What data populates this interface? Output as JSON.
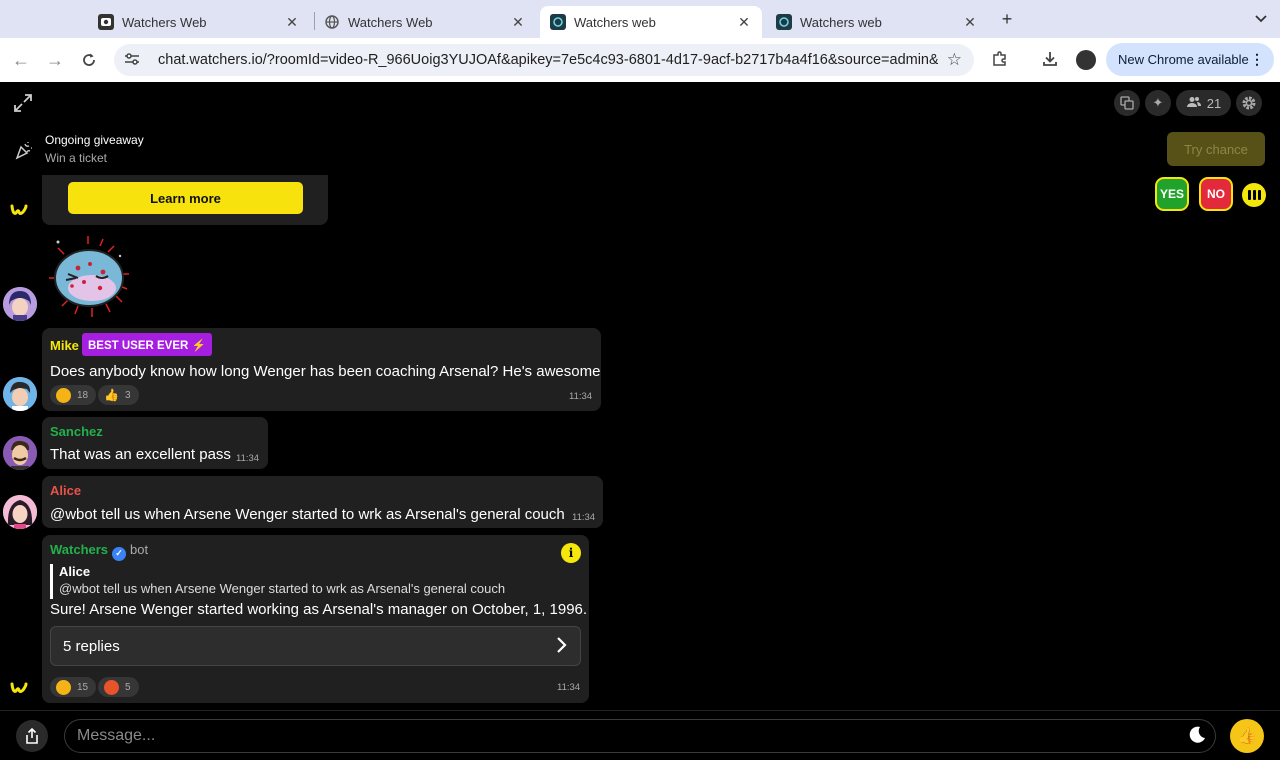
{
  "browser": {
    "tabs": [
      {
        "title": "Watchers Web",
        "close": "✕"
      },
      {
        "title": "Watchers Web",
        "close": "✕"
      },
      {
        "title": "Watchers web",
        "close": "✕"
      },
      {
        "title": "Watchers web",
        "close": "✕"
      }
    ],
    "new_tab": "+",
    "url": "chat.watchers.io/?roomId=video-R_966Uoig3YUJOAf&apikey=7e5c4c93-6801-4d17-9acf-b2717b4a4f16&source=admin&...",
    "update_label": "New Chrome available"
  },
  "app": {
    "viewer_count": "21",
    "giveaway": {
      "title": "Ongoing giveaway",
      "subtitle": "Win a ticket",
      "button": "Learn more"
    },
    "try_chance": "Try chance",
    "poll": {
      "yes": "YES",
      "no": "NO"
    },
    "messages": [
      {
        "author": "Mike",
        "author_color": "#f5e70b",
        "badge": "BEST USER EVER ⚡",
        "text": "Does anybody know how long Wenger has been coaching Arsenal? He's awesome",
        "time": "11:34",
        "reactions": [
          {
            "emoji": "heart-eyes",
            "count": "18"
          },
          {
            "emoji": "thumbs-up",
            "count": "3"
          }
        ]
      },
      {
        "author": "Sanchez",
        "author_color": "#22b14c",
        "text": "That was an excellent pass",
        "time": "11:34"
      },
      {
        "author": "Alice",
        "author_color": "#e8534a",
        "text": "@wbot tell us when Arsene Wenger started to wrk as Arsenal's general couch",
        "time": "11:34"
      },
      {
        "author": "Watchers",
        "author_color": "#22b14c",
        "tag": "bot",
        "quote_author": "Alice",
        "quote_text": "@wbot tell us when Arsene Wenger started to wrk as Arsenal's general couch",
        "text": "Sure! Arsene Wenger started working as Arsenal's manager on October, 1, 1996.",
        "replies": "5 replies",
        "time": "11:34",
        "reactions": [
          {
            "emoji": "heart-eyes",
            "count": "15"
          },
          {
            "emoji": "angry",
            "count": "5"
          }
        ]
      }
    ],
    "input_placeholder": "Message..."
  }
}
